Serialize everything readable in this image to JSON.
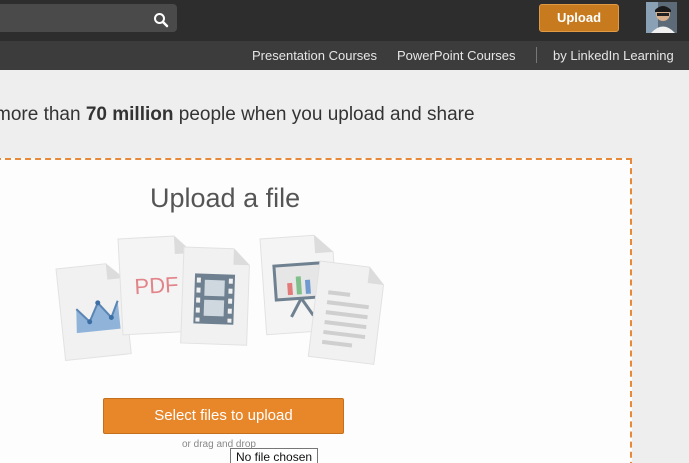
{
  "header": {
    "upload_label": "Upload"
  },
  "subnav": {
    "items": [
      "Presentation Courses",
      "PowerPoint Courses",
      "by LinkedIn Learning"
    ]
  },
  "tagline": {
    "prefix": "more than ",
    "bold": "70 million",
    "suffix": " people when you upload and share"
  },
  "upload": {
    "title": "Upload a file",
    "pdf_label": "PDF",
    "select_label": "Select files to upload",
    "drag_note": "or drag and drop",
    "file_tooltip": "No file chosen"
  },
  "icons": [
    "search-icon",
    "avatar",
    "chart-doc-icon",
    "pdf-doc-icon",
    "video-doc-icon",
    "presentation-doc-icon",
    "text-doc-icon"
  ],
  "colors": {
    "accent": "#e8862a",
    "upload_button": "#c87a1e",
    "topbar": "#2d2d2d",
    "subnav": "#3c3c3c"
  }
}
